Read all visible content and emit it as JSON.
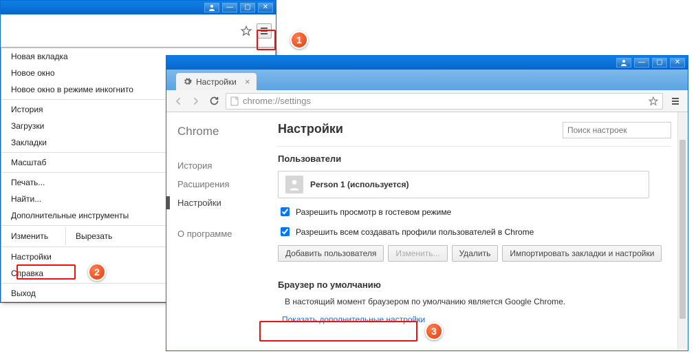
{
  "menu": {
    "items": [
      "Новая вкладка",
      "Новое окно",
      "Новое окно в режиме инкогнито",
      "История",
      "Загрузки",
      "Закладки",
      "Масштаб",
      "Печать...",
      "Найти...",
      "Дополнительные инструменты",
      "Настройки",
      "Справка",
      "Выход"
    ],
    "edit_row": {
      "col1": "Изменить",
      "col2": "Вырезать"
    }
  },
  "callouts": {
    "c1": "1",
    "c2": "2",
    "c3": "3"
  },
  "settings_window": {
    "tab_label": "Настройки",
    "url": "chrome://settings",
    "sidebar": {
      "title": "Chrome",
      "items": [
        "История",
        "Расширения",
        "Настройки"
      ],
      "about": "О программе",
      "active_index": 2
    },
    "page_title": "Настройки",
    "search_placeholder": "Поиск настроек",
    "users_section": {
      "title": "Пользователи",
      "person_label": "Person 1 (используется)",
      "chk1": "Разрешить просмотр в гостевом режиме",
      "chk2": "Разрешить всем создавать профили пользователей в Chrome",
      "buttons": [
        "Добавить пользователя",
        "Изменить...",
        "Удалить",
        "Импортировать закладки и настройки"
      ],
      "disabled_index": 1
    },
    "default_section": {
      "title": "Браузер по умолчанию",
      "text": "В настоящий момент браузером по умолчанию является Google Chrome."
    },
    "show_more": "Показать дополнительные настройки"
  }
}
